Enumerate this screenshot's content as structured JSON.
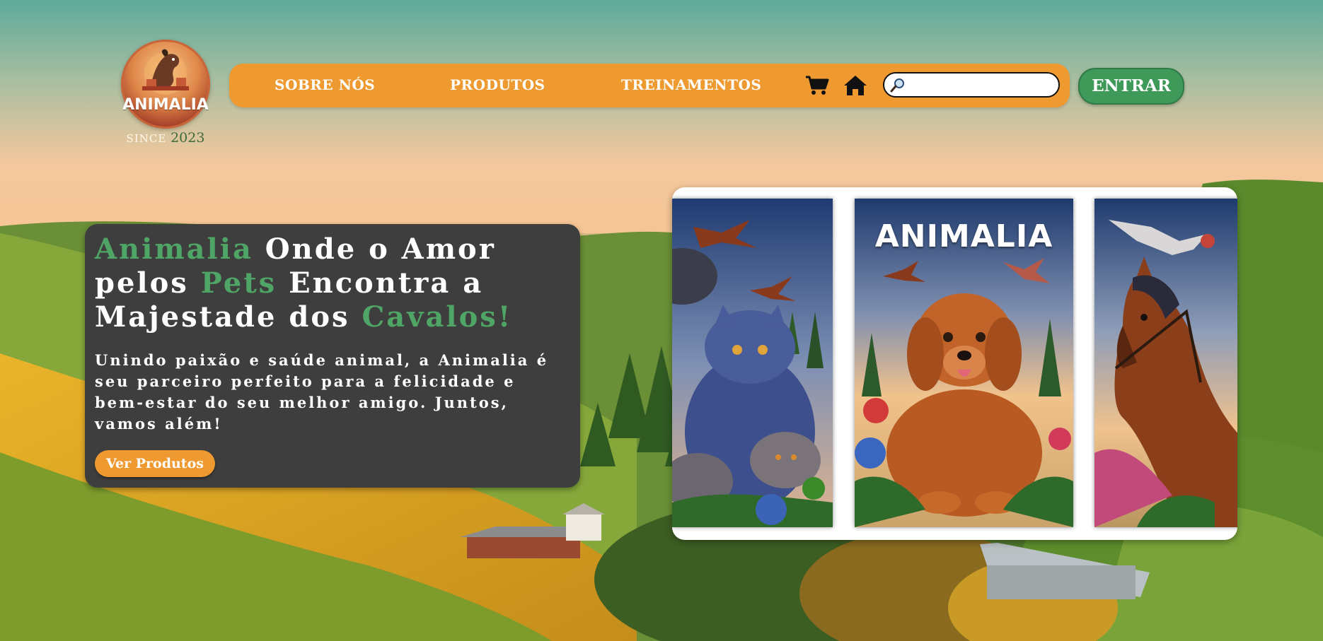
{
  "logo": {
    "word": "ANIMALIA",
    "since_label": "SINCE",
    "since_year": "2023"
  },
  "nav": {
    "links": [
      {
        "label": "SOBRE NÓS"
      },
      {
        "label": "PRODUTOS"
      },
      {
        "label": "TREINAMENTOS"
      }
    ],
    "cart_icon": "shopping-cart-icon",
    "home_icon": "home-icon",
    "search": {
      "icon": "magnifier-icon",
      "placeholder": "",
      "value": ""
    },
    "login_label": "ENTRAR"
  },
  "hero": {
    "title_parts": [
      {
        "text": "Animalia",
        "highlight": true
      },
      {
        "text": " Onde o Amor pelos ",
        "highlight": false
      },
      {
        "text": "Pets",
        "highlight": true
      },
      {
        "text": " Encontra a Majestade dos ",
        "highlight": false
      },
      {
        "text": "Cavalos!",
        "highlight": true
      }
    ],
    "subtitle": "Unindo paixão e saúde animal, a Animalia é seu parceiro perfeito para a felicidade e bem-estar do seu melhor amigo. Juntos, vamos além!",
    "cta_label": "Ver Produtos"
  },
  "gallery": {
    "banner_text": "ANIMALIA",
    "panels": [
      "cats-and-birds-image",
      "golden-retriever-image",
      "horse-and-bird-image"
    ]
  },
  "colors": {
    "accent_orange": "#ef9a30",
    "accent_green": "#4ea565",
    "button_green": "#3f9a5a",
    "card_dark": "#3e3e3e"
  }
}
